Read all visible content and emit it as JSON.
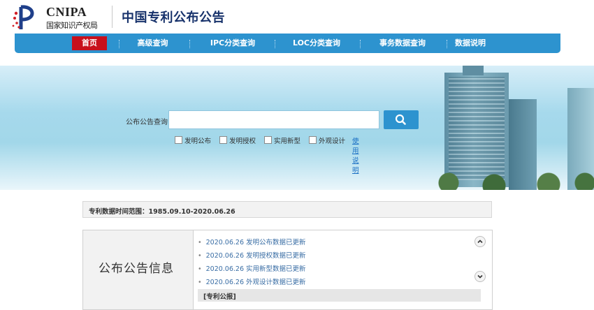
{
  "header": {
    "logo_latin": "CNIPA",
    "logo_chinese": "国家知识产权局",
    "site_title": "中国专利公布公告"
  },
  "nav": {
    "items": [
      {
        "label": "首页",
        "active": true
      },
      {
        "label": "高级查询",
        "active": false
      },
      {
        "label": "IPC分类查询",
        "active": false
      },
      {
        "label": "LOC分类查询",
        "active": false
      },
      {
        "label": "事务数据查询",
        "active": false
      },
      {
        "label": "数据说明",
        "active": false
      }
    ]
  },
  "search": {
    "label": "公布公告查询",
    "value": "",
    "button_icon": "search-icon",
    "options": [
      {
        "label": "发明公布",
        "checked": false
      },
      {
        "label": "发明授权",
        "checked": false
      },
      {
        "label": "实用新型",
        "checked": false
      },
      {
        "label": "外观设计",
        "checked": false
      }
    ],
    "help_link": "使用说明"
  },
  "data_range": {
    "text": "专利数据时间范围：1985.09.10-2020.06.26"
  },
  "info": {
    "title": "公布公告信息",
    "news": [
      "2020.06.26 发明公布数据已更新",
      "2020.06.26 发明授权数据已更新",
      "2020.06.26 实用新型数据已更新",
      "2020.06.26 外观设计数据已更新"
    ],
    "section_label": "[专利公报]"
  },
  "colors": {
    "nav_bg": "#2d93cf",
    "nav_active": "#c8101c",
    "title_color": "#17326b",
    "link_color": "#3a6ea5"
  }
}
